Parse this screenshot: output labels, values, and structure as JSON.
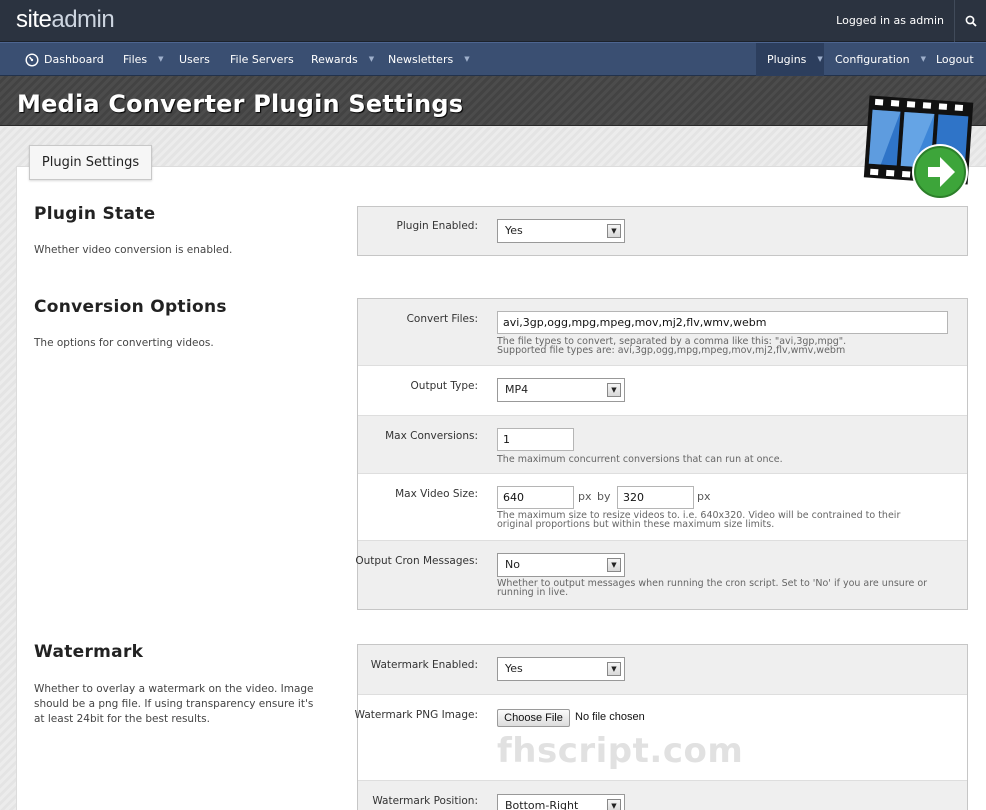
{
  "app": {
    "logo_bold": "site",
    "logo_light": "admin",
    "logged_in_text": "Logged in as admin",
    "search_icon": "search-icon"
  },
  "nav": {
    "dashboard": "Dashboard",
    "files": "Files",
    "users": "Users",
    "file_servers": "File Servers",
    "rewards": "Rewards",
    "newsletters": "Newsletters",
    "plugins": "Plugins",
    "configuration": "Configuration",
    "logout": "Logout"
  },
  "page": {
    "title": "Media Converter Plugin Settings",
    "tab": "Plugin Settings",
    "watermark_text": "fhscript.com"
  },
  "sections": {
    "plugin_state": {
      "title": "Plugin State",
      "desc": "Whether video conversion is enabled.",
      "plugin_enabled_label": "Plugin Enabled:",
      "plugin_enabled_value": "Yes"
    },
    "conversion": {
      "title": "Conversion Options",
      "desc": "The options for converting videos.",
      "convert_files_label": "Convert Files:",
      "convert_files_value": "avi,3gp,ogg,mpg,mpeg,mov,mj2,flv,wmv,webm",
      "convert_files_hint1": "The file types to convert, separated by a comma like this: \"avi,3gp,mpg\".",
      "convert_files_hint2": "Supported file types are: avi,3gp,ogg,mpg,mpeg,mov,mj2,flv,wmv,webm",
      "output_type_label": "Output Type:",
      "output_type_value": "MP4",
      "max_conversions_label": "Max Conversions:",
      "max_conversions_value": "1",
      "max_conversions_hint": "The maximum concurrent conversions that can run at once.",
      "max_video_size_label": "Max Video Size:",
      "width_value": "640",
      "height_value": "320",
      "unit_px": "px",
      "by": "by",
      "max_video_size_hint1": "The maximum size to resize videos to. i.e. 640x320. Video will be contrained to their",
      "max_video_size_hint2": "original proportions but within these maximum size limits.",
      "cron_label": "Output Cron Messages:",
      "cron_value": "No",
      "cron_hint1": "Whether to output messages when running the cron script. Set to 'No' if you are unsure or",
      "cron_hint2": "running in live."
    },
    "watermark": {
      "title": "Watermark",
      "desc": "Whether to overlay a watermark on the video. Image should be a png file. If using transparency ensure it's at least 24bit for the best results.",
      "enabled_label": "Watermark Enabled:",
      "enabled_value": "Yes",
      "png_label": "Watermark PNG Image:",
      "choose_file": "Choose File",
      "no_file": "No file chosen",
      "position_label": "Watermark Position:",
      "position_value": "Bottom-Right"
    }
  },
  "colors": {
    "topbar": "#2b3340",
    "nav": "#3a4f72",
    "accent_green": "#3da53a"
  }
}
